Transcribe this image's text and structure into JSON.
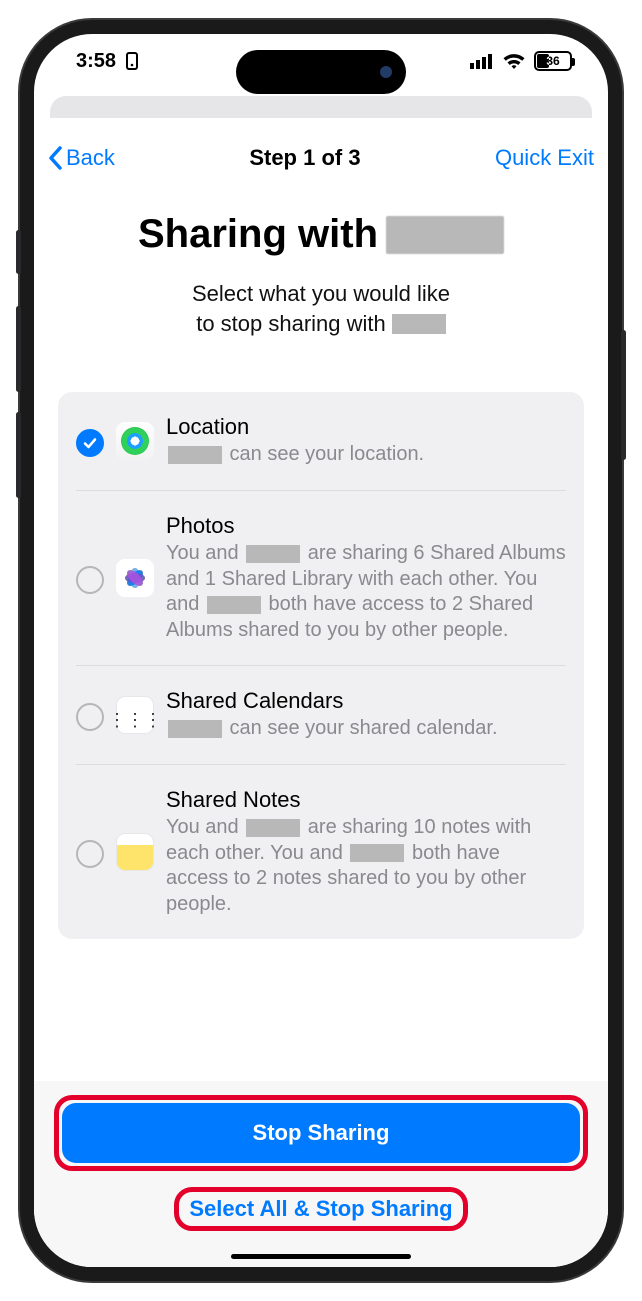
{
  "status": {
    "time": "3:58",
    "battery_pct": "36"
  },
  "nav": {
    "back": "Back",
    "title": "Step 1 of 3",
    "quick_exit": "Quick Exit"
  },
  "header": {
    "title_prefix": "Sharing with",
    "subtitle_line1": "Select what you would like",
    "subtitle_line2_prefix": "to stop sharing with"
  },
  "options": [
    {
      "id": "location",
      "title": "Location",
      "selected": true,
      "desc_parts": [
        "",
        " can see your location."
      ]
    },
    {
      "id": "photos",
      "title": "Photos",
      "selected": false,
      "desc_parts": [
        "You and ",
        " are sharing 6 Shared Albums and 1 Shared Library with each other. You and ",
        " both have access to 2 Shared Albums shared to you by other people."
      ]
    },
    {
      "id": "calendars",
      "title": "Shared Calendars",
      "selected": false,
      "desc_parts": [
        "",
        " can see your shared calendar."
      ]
    },
    {
      "id": "notes",
      "title": "Shared Notes",
      "selected": false,
      "desc_parts": [
        "You and ",
        " are sharing 10 notes with each other. You and ",
        " both have access to 2 notes shared to you by other people."
      ]
    }
  ],
  "footer": {
    "primary": "Stop Sharing",
    "secondary": "Select All & Stop Sharing"
  }
}
